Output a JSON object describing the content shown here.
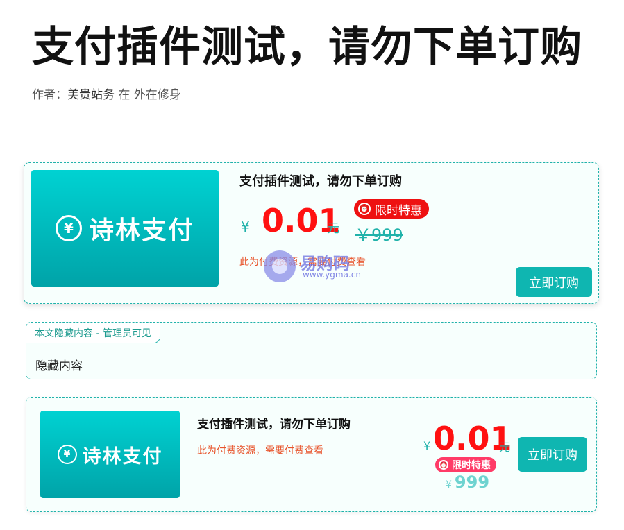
{
  "page": {
    "title": "支付插件测试，请勿下单订购",
    "meta_prefix": "作者：",
    "author": "美贵站务",
    "meta_suffix": "在 外在修身"
  },
  "card1": {
    "thumb_brand": "诗林支付",
    "thumb_yen": "¥",
    "product_title": "支付插件测试，请勿下单订购",
    "currency": "¥",
    "price": "0.01",
    "unit": "元",
    "badge": "限时特惠",
    "original_price": "￥999",
    "note": "此为付费资源，需要付费查看",
    "buy_button": "立即订购"
  },
  "watermark": {
    "text": "易购码",
    "url": "www.ygma.cn"
  },
  "hidden": {
    "tab_label": "本文隐藏内容 - 管理员可见",
    "content": "隐藏内容"
  },
  "card2": {
    "thumb_brand": "诗林支付",
    "thumb_yen": "¥",
    "product_title": "支付插件测试，请勿下单订购",
    "note": "此为付费资源，需要付费查看",
    "currency": "¥",
    "price": "0.01",
    "unit": "元",
    "badge": "限时特惠",
    "original_currency": "¥",
    "original_price": "999",
    "buy_button": "立即订购"
  },
  "icons": {
    "alarm": "alarm-clock-icon",
    "yen": "yen-circle-icon"
  },
  "colors": {
    "accent": "#20b2aa",
    "button": "#0fb6b1",
    "price": "#ff1111",
    "badge": "#ee1111",
    "note": "#e8542c"
  }
}
